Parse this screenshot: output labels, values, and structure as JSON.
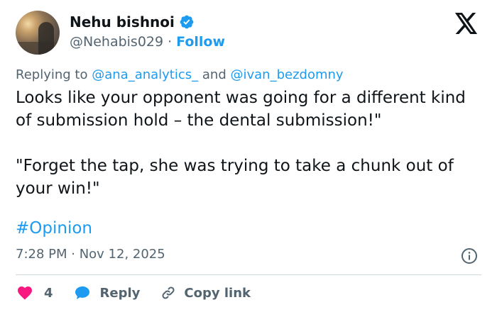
{
  "author": {
    "name": "Nehu bishnoi",
    "handle": "@Nehabis029",
    "separator": "·",
    "follow_label": "Follow"
  },
  "reply_context": {
    "prefix": "Replying to",
    "user1": "@ana_analytics_",
    "conjunction": "and",
    "user2": "@ivan_bezdomny"
  },
  "tweet": {
    "paragraph1": "Looks like your opponent was going for a different kind of submission hold – the dental submission!\"",
    "paragraph2": "\"Forget the tap, she was trying to take a chunk out of your win!\"",
    "hashtag": "#Opinion"
  },
  "meta": {
    "timestamp": "7:28 PM · Nov 12, 2025"
  },
  "actions": {
    "like_count": "4",
    "reply_label": "Reply",
    "copy_link_label": "Copy link"
  },
  "colors": {
    "accent": "#1d9bf0",
    "like": "#f91880",
    "muted": "#536471",
    "text": "#0f1419",
    "divider": "#cfd9de"
  },
  "icons": [
    "verified-badge-icon",
    "x-logo-icon",
    "info-icon",
    "heart-icon",
    "reply-bubble-icon",
    "link-icon"
  ]
}
